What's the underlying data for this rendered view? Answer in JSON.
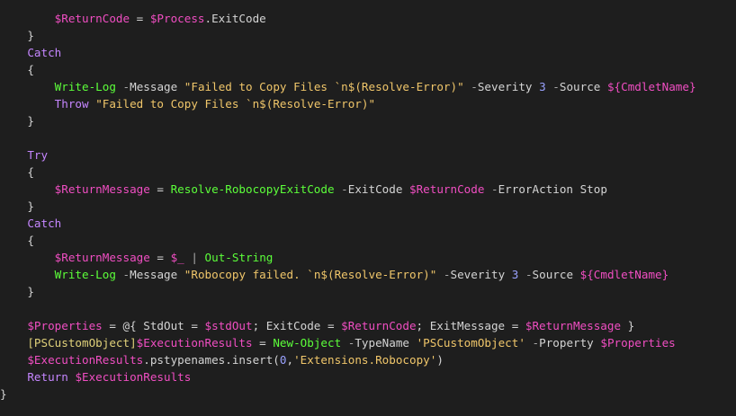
{
  "colors": {
    "background": "#1e1e1e",
    "plain": "#d4d4d4",
    "variable": "#f04ec2",
    "keyword": "#c586ff",
    "command": "#5cff3a",
    "string": "#f0c66a",
    "operator": "#a8a8a8",
    "number": "#9aa2ff",
    "type": "#e0d17a"
  },
  "lines": [
    [
      [
        "p",
        "        "
      ],
      [
        "v",
        "$ReturnCode"
      ],
      [
        "p",
        " = "
      ],
      [
        "v",
        "$Process"
      ],
      [
        "p",
        ".ExitCode"
      ]
    ],
    [
      [
        "p",
        "    }"
      ]
    ],
    [
      [
        "p",
        "    "
      ],
      [
        "k",
        "Catch"
      ]
    ],
    [
      [
        "p",
        "    {"
      ]
    ],
    [
      [
        "p",
        "        "
      ],
      [
        "c",
        "Write-Log"
      ],
      [
        "p",
        " "
      ],
      [
        "o",
        "-"
      ],
      [
        "p",
        "Message "
      ],
      [
        "s",
        "\"Failed to Copy Files `n$(Resolve-Error)\""
      ],
      [
        "p",
        " "
      ],
      [
        "o",
        "-"
      ],
      [
        "p",
        "Severity "
      ],
      [
        "n",
        "3"
      ],
      [
        "p",
        " "
      ],
      [
        "o",
        "-"
      ],
      [
        "p",
        "Source "
      ],
      [
        "v",
        "${CmdletName}"
      ]
    ],
    [
      [
        "p",
        "        "
      ],
      [
        "k",
        "Throw"
      ],
      [
        "p",
        " "
      ],
      [
        "s",
        "\"Failed to Copy Files `n$(Resolve-Error)\""
      ]
    ],
    [
      [
        "p",
        "    }"
      ]
    ],
    [
      [
        "p",
        ""
      ]
    ],
    [
      [
        "p",
        "    "
      ],
      [
        "k",
        "Try"
      ]
    ],
    [
      [
        "p",
        "    {"
      ]
    ],
    [
      [
        "p",
        "        "
      ],
      [
        "v",
        "$ReturnMessage"
      ],
      [
        "p",
        " = "
      ],
      [
        "c",
        "Resolve-RobocopyExitCode"
      ],
      [
        "p",
        " "
      ],
      [
        "o",
        "-"
      ],
      [
        "p",
        "ExitCode "
      ],
      [
        "v",
        "$ReturnCode"
      ],
      [
        "p",
        " "
      ],
      [
        "o",
        "-"
      ],
      [
        "p",
        "ErrorAction Stop"
      ]
    ],
    [
      [
        "p",
        "    }"
      ]
    ],
    [
      [
        "p",
        "    "
      ],
      [
        "k",
        "Catch"
      ]
    ],
    [
      [
        "p",
        "    {"
      ]
    ],
    [
      [
        "p",
        "        "
      ],
      [
        "v",
        "$ReturnMessage"
      ],
      [
        "p",
        " = "
      ],
      [
        "v",
        "$_"
      ],
      [
        "p",
        " "
      ],
      [
        "o",
        "|"
      ],
      [
        "p",
        " "
      ],
      [
        "c",
        "Out-String"
      ]
    ],
    [
      [
        "p",
        "        "
      ],
      [
        "c",
        "Write-Log"
      ],
      [
        "p",
        " "
      ],
      [
        "o",
        "-"
      ],
      [
        "p",
        "Message "
      ],
      [
        "s",
        "\"Robocopy failed. `n$(Resolve-Error)\""
      ],
      [
        "p",
        " "
      ],
      [
        "o",
        "-"
      ],
      [
        "p",
        "Severity "
      ],
      [
        "n",
        "3"
      ],
      [
        "p",
        " "
      ],
      [
        "o",
        "-"
      ],
      [
        "p",
        "Source "
      ],
      [
        "v",
        "${CmdletName}"
      ]
    ],
    [
      [
        "p",
        "    }"
      ]
    ],
    [
      [
        "p",
        ""
      ]
    ],
    [
      [
        "p",
        "    "
      ],
      [
        "v",
        "$Properties"
      ],
      [
        "p",
        " = @{ StdOut = "
      ],
      [
        "v",
        "$stdOut"
      ],
      [
        "p",
        "; ExitCode = "
      ],
      [
        "v",
        "$ReturnCode"
      ],
      [
        "p",
        "; ExitMessage = "
      ],
      [
        "v",
        "$ReturnMessage"
      ],
      [
        "p",
        " }"
      ]
    ],
    [
      [
        "p",
        "    "
      ],
      [
        "t",
        "[PSCustomObject]"
      ],
      [
        "v",
        "$ExecutionResults"
      ],
      [
        "p",
        " = "
      ],
      [
        "c",
        "New-Object"
      ],
      [
        "p",
        " "
      ],
      [
        "o",
        "-"
      ],
      [
        "p",
        "TypeName "
      ],
      [
        "s",
        "'PSCustomObject'"
      ],
      [
        "p",
        " "
      ],
      [
        "o",
        "-"
      ],
      [
        "p",
        "Property "
      ],
      [
        "v",
        "$Properties"
      ]
    ],
    [
      [
        "p",
        "    "
      ],
      [
        "v",
        "$ExecutionResults"
      ],
      [
        "p",
        ".pstypenames.insert("
      ],
      [
        "n",
        "0"
      ],
      [
        "p",
        ","
      ],
      [
        "s",
        "'Extensions.Robocopy'"
      ],
      [
        "p",
        ")"
      ]
    ],
    [
      [
        "p",
        "    "
      ],
      [
        "k",
        "Return"
      ],
      [
        "p",
        " "
      ],
      [
        "v",
        "$ExecutionResults"
      ]
    ],
    [
      [
        "p",
        "}"
      ]
    ]
  ]
}
